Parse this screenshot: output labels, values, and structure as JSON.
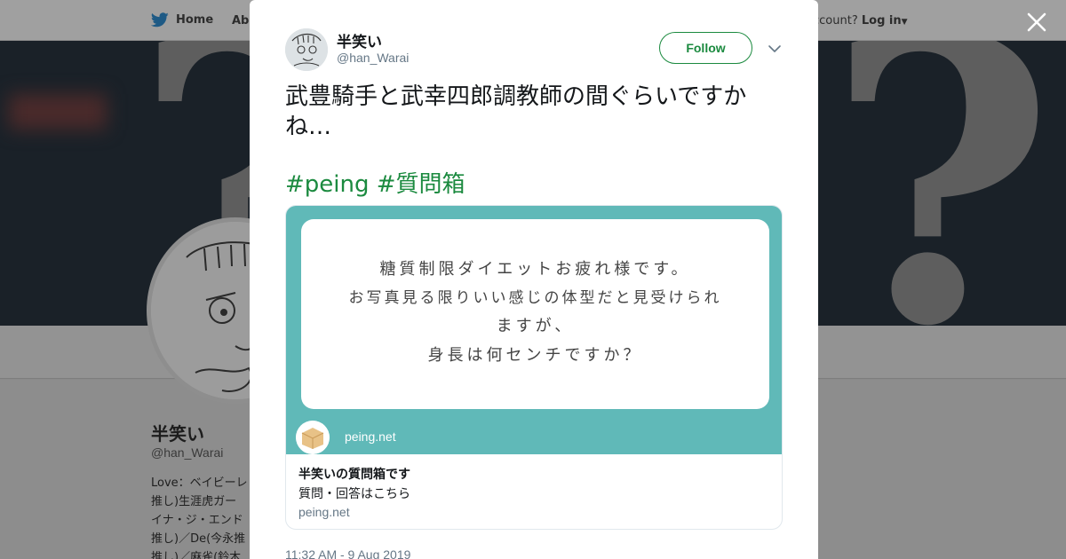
{
  "nav": {
    "home_label": "Home",
    "about_label": "Abo",
    "account_text": "ccount?",
    "login_label": "Log in"
  },
  "profile": {
    "name": "半笑い",
    "handle": "@han_Warai",
    "bio_lines": [
      "Love：ベイビーレ",
      "推し)生涯虎ガー",
      "イナ・ジ・エンド",
      "推し)／De(今永推",
      "推し)／麻雀(鈴木"
    ]
  },
  "tweet": {
    "author_name": "半笑い",
    "author_handle": "@han_Warai",
    "follow_label": "Follow",
    "text": "武豊騎手と武幸四郎調教師の間ぐらいですかね…",
    "hashtags": [
      "#peing",
      "#質問箱"
    ],
    "timestamp": "11:32 AM - 9 Aug 2019"
  },
  "card": {
    "question_lines": [
      "糖質制限ダイエットお疲れ様です。",
      "お写真見る限りいい感じの体型だと見受けられ",
      "ますが、",
      "身長は何センチですか？"
    ],
    "image_site": "peing.net",
    "title": "半笑いの質問箱です",
    "description": "質問・回答はこちら",
    "domain": "peing.net"
  },
  "colors": {
    "accent_green": "#1b8a3f",
    "card_teal": "#60b9b8",
    "muted_text": "#657786"
  },
  "icons": [
    "twitter-bird-icon",
    "close-icon",
    "chevron-down-icon"
  ]
}
